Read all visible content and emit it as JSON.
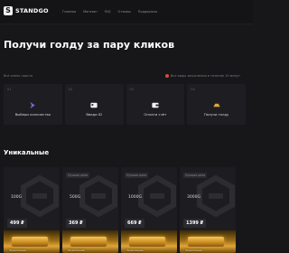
{
  "header": {
    "logo_text": "STANDGO",
    "logo_mark": "S",
    "nav": [
      "Главная",
      "Магазин",
      "FAQ",
      "Отзывы",
      "Поддержка"
    ]
  },
  "hero": {
    "title": "Получи голду за пару кликов"
  },
  "breadcrumb": "Всё очень просто",
  "warning": "Все виды зачисления в течение 10 минут",
  "steps": [
    {
      "num": "01",
      "label": "Выбери количество",
      "icon": "chevron-right-icon"
    },
    {
      "num": "02",
      "label": "Введи ID",
      "icon": "id-card-icon"
    },
    {
      "num": "03",
      "label": "Оплати счёт",
      "icon": "wallet-icon"
    },
    {
      "num": "04",
      "label": "Получи голду",
      "icon": "gold-icon"
    }
  ],
  "section": {
    "title": "Уникальные"
  },
  "cards": [
    {
      "badge": "",
      "amount": "100G",
      "price": "499 ₽",
      "caption": "Зачисление"
    },
    {
      "badge": "Лучшая цена",
      "amount": "500G",
      "price": "369 ₽",
      "caption": "Зачисление"
    },
    {
      "badge": "Лучшая цена",
      "amount": "1000G",
      "price": "669 ₽",
      "caption": "Зачисление"
    },
    {
      "badge": "Лучшая цена",
      "amount": "3000G",
      "price": "1399 ₽",
      "caption": "Зачисление"
    }
  ],
  "colors": {
    "background": "#17171a",
    "card": "#1e1e22",
    "accent": "#d94a3a",
    "gold": "#e0a538"
  }
}
